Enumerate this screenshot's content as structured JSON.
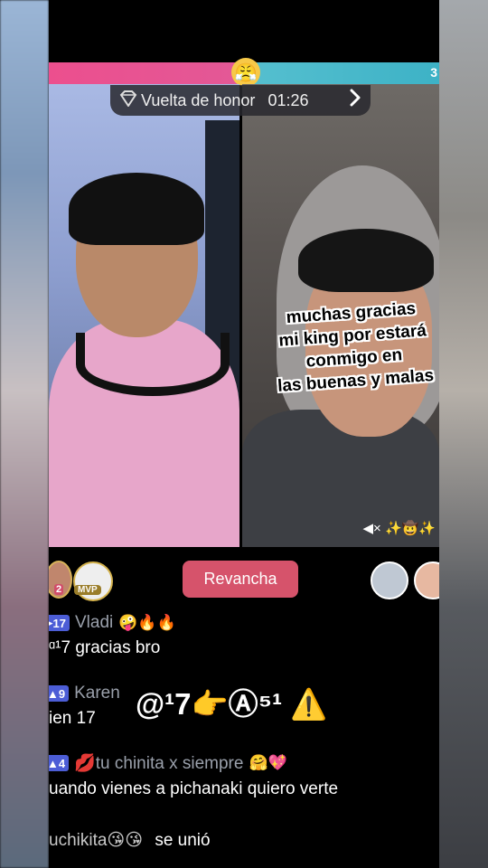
{
  "battle": {
    "emoji": "😤",
    "score_right": "3"
  },
  "honor": {
    "icon": "diamond-crown-icon",
    "label": "Vuelta de honor",
    "timer": "01:26",
    "chevron": "›"
  },
  "overlay": {
    "lines": [
      "muchas gracias",
      "mi king por estará",
      "conmigo en",
      "las buenas y malas"
    ]
  },
  "right_video": {
    "icons": "◀× ✨🤠✨"
  },
  "controls": {
    "left_avatar_badge": "2",
    "mvp_label": "MVP",
    "rematch_label": "Revancha"
  },
  "chat": [
    {
      "level": "17",
      "name": "Vladi",
      "name_emojis": "🤪🔥🔥",
      "message": "ᵅ¹7 gracias bro"
    },
    {
      "level": "9",
      "name": "Karen",
      "name_emojis": "",
      "message": "ien 17"
    },
    {
      "level": "4",
      "name": "💋tu chinita x siempre",
      "name_emojis": "🤗💖",
      "message": "uando vienes a pichanaki quiero verte"
    }
  ],
  "sticker": {
    "text": "@¹7👉Ⓐ⁵¹",
    "warn": "⚠️"
  },
  "join": {
    "name": "uchikita😘😘",
    "action": "se unió"
  },
  "colors": {
    "left_bar": "#e35896",
    "right_bar": "#3db2c6",
    "rematch": "#d6536b",
    "level_badge": "#4c5dd6"
  }
}
